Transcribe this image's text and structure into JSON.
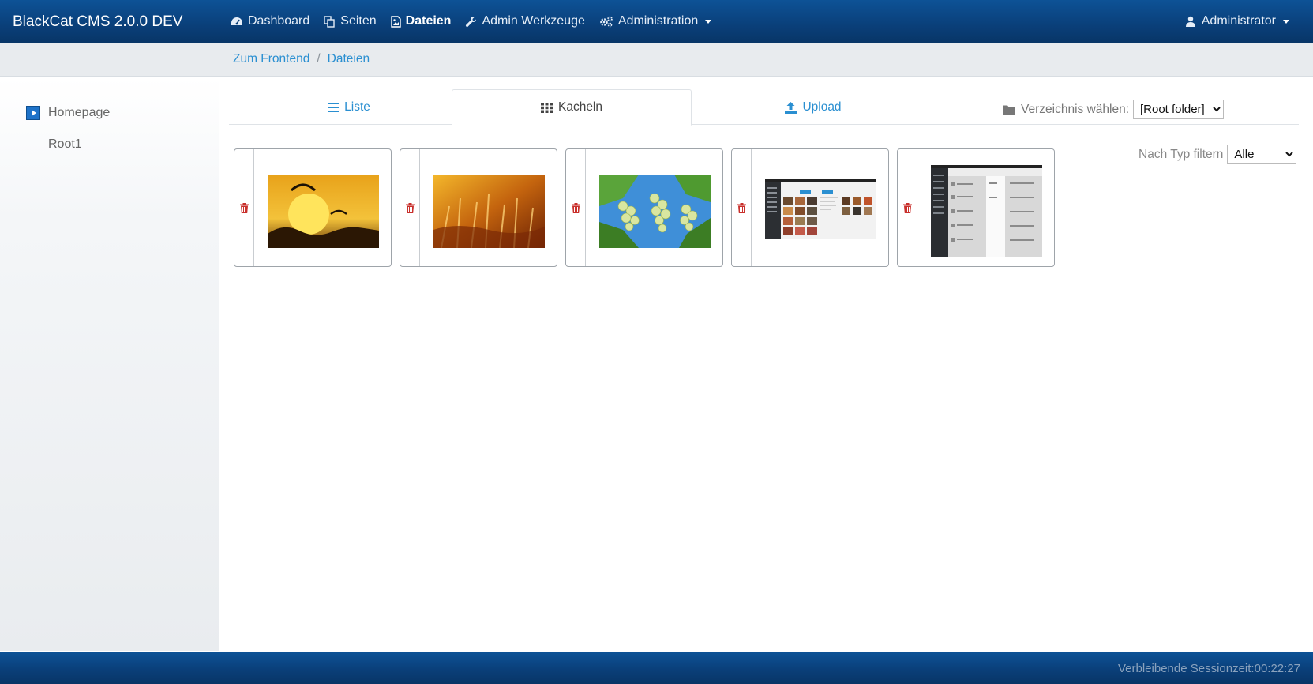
{
  "app": {
    "brand": "BlackCat CMS 2.0.0 DEV"
  },
  "nav": {
    "items": [
      {
        "label": "Dashboard",
        "icon": "dashboard-icon"
      },
      {
        "label": "Seiten",
        "icon": "copy-icon"
      },
      {
        "label": "Dateien",
        "icon": "file-image-icon",
        "active": true
      },
      {
        "label": "Admin Werkzeuge",
        "icon": "wrench-icon"
      },
      {
        "label": "Administration",
        "icon": "cogs-icon",
        "dropdown": true
      }
    ],
    "user": "Administrator"
  },
  "breadcrumb": {
    "items": [
      "Zum Frontend",
      "Dateien"
    ],
    "separator": "/"
  },
  "sidebar": {
    "items": [
      "Homepage",
      "Root1"
    ]
  },
  "tabs": [
    {
      "label": "Liste",
      "icon": "list-icon"
    },
    {
      "label": "Kacheln",
      "icon": "th-icon",
      "active": true
    },
    {
      "label": "Upload",
      "icon": "upload-icon"
    }
  ],
  "directory": {
    "label": "Verzeichnis wählen:",
    "value": "[Root folder]"
  },
  "type_filter": {
    "label": "Nach Typ filtern",
    "value": "Alle"
  },
  "files": [
    {
      "kind": "photo-sunset-paragliders"
    },
    {
      "kind": "photo-golden-grass"
    },
    {
      "kind": "photo-green-grapes"
    },
    {
      "kind": "screenshot-media-grid"
    },
    {
      "kind": "screenshot-dark-admin"
    }
  ],
  "footer": {
    "session_label": "Verbleibende Sessionzeit:",
    "session_time": "00:22:27"
  },
  "colors": {
    "navbar": "#0a3f79",
    "link": "#2a8fd1",
    "delete": "#c9302c",
    "tree_toggle": "#1e73c9"
  }
}
